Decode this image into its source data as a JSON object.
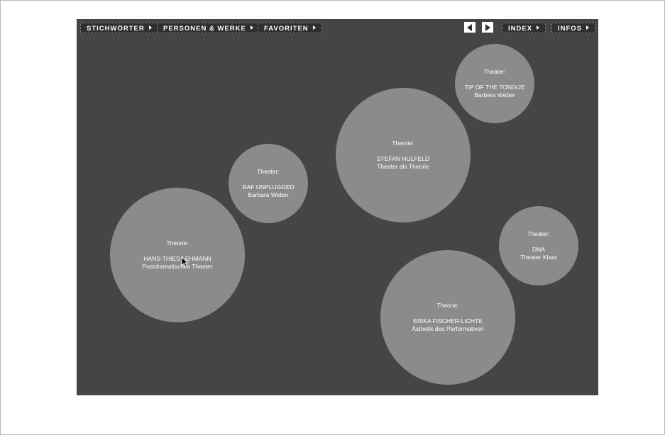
{
  "nav": {
    "stichwoerter": "STICHWÖRTER",
    "personen": "PERSONEN & WERKE",
    "favoriten": "FAVORITEN",
    "index": "INDEX",
    "infos": "INFOS",
    "prev_icon": "triangle-left-icon",
    "next_icon": "triangle-right-icon"
  },
  "bubbles": [
    {
      "category": "Theater:",
      "title": "TIP OF THE TONGUE",
      "subtitle": "Barbara Weber"
    },
    {
      "category": "Theorie:",
      "title": "STEFAN HULFELD",
      "subtitle": "Theater als Theorie"
    },
    {
      "category": "Theater:",
      "title": "RAF UNPLUGGED",
      "subtitle": "Barbara Weber"
    },
    {
      "category": "Theorie:",
      "title": "HANS-THIES LEHMANN",
      "subtitle": "Postdramatisches Theater"
    },
    {
      "category": "Theater:",
      "title": "DNA",
      "subtitle": "Theater Klara"
    },
    {
      "category": "Theorie:",
      "title": "ERIKA FISCHER-LICHTE",
      "subtitle": "Ästhetik des Performativen"
    }
  ],
  "colors": {
    "stage": "#454545",
    "bubble": "#8b8b8b",
    "button": "#2f2f2f",
    "text": "#ffffff"
  }
}
